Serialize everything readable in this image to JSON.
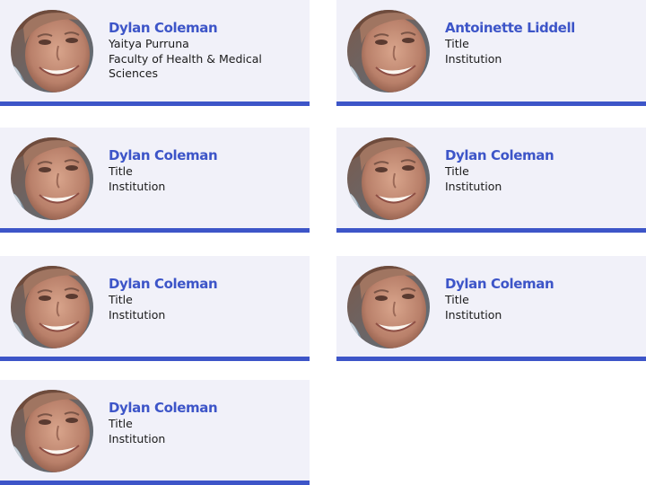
{
  "colors": {
    "accent": "#3d55c8",
    "card_background": "#f1f1f9",
    "text": "#1b1b1b"
  },
  "cards": [
    {
      "name": "Dylan Coleman",
      "lines": [
        "Yaitya Purruna",
        "Faculty of Health & Medical",
        "Sciences"
      ],
      "avatar_icon": "person-portrait-photo"
    },
    {
      "name": "Antoinette Liddell",
      "lines": [
        "Title",
        "Institution"
      ],
      "avatar_icon": "person-portrait-photo"
    },
    {
      "name": "Dylan Coleman",
      "lines": [
        "Title",
        "Institution"
      ],
      "avatar_icon": "person-portrait-photo"
    },
    {
      "name": "Dylan Coleman",
      "lines": [
        "Title",
        "Institution"
      ],
      "avatar_icon": "person-portrait-photo"
    },
    {
      "name": "Dylan Coleman",
      "lines": [
        "Title",
        "Institution"
      ],
      "avatar_icon": "person-portrait-photo"
    },
    {
      "name": "Dylan Coleman",
      "lines": [
        "Title",
        "Institution"
      ],
      "avatar_icon": "person-portrait-photo"
    },
    {
      "name": "Dylan Coleman",
      "lines": [
        "Title",
        "Institution"
      ],
      "avatar_icon": "person-portrait-photo"
    }
  ]
}
